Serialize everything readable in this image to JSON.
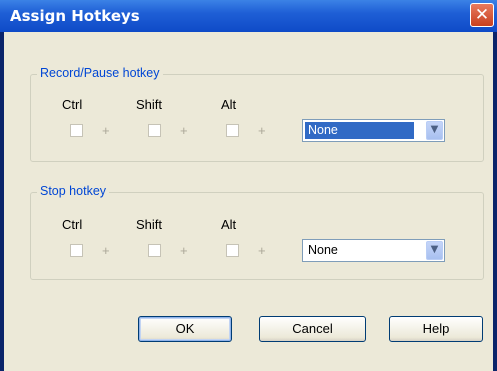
{
  "window": {
    "title": "Assign Hotkeys",
    "close_icon": "close-icon"
  },
  "record_group": {
    "legend": "Record/Pause hotkey",
    "ctrl_label": "Ctrl",
    "shift_label": "Shift",
    "alt_label": "Alt",
    "plus": "+",
    "key_value": "None"
  },
  "stop_group": {
    "legend": "Stop hotkey",
    "ctrl_label": "Ctrl",
    "shift_label": "Shift",
    "alt_label": "Alt",
    "plus": "+",
    "key_value": "None"
  },
  "buttons": {
    "ok": "OK",
    "cancel": "Cancel",
    "help": "Help"
  },
  "colors": {
    "title_bar": "#1f5fd6",
    "dialog_bg": "#ece9d8",
    "legend_text": "#0046d5",
    "selection": "#316ac5"
  }
}
